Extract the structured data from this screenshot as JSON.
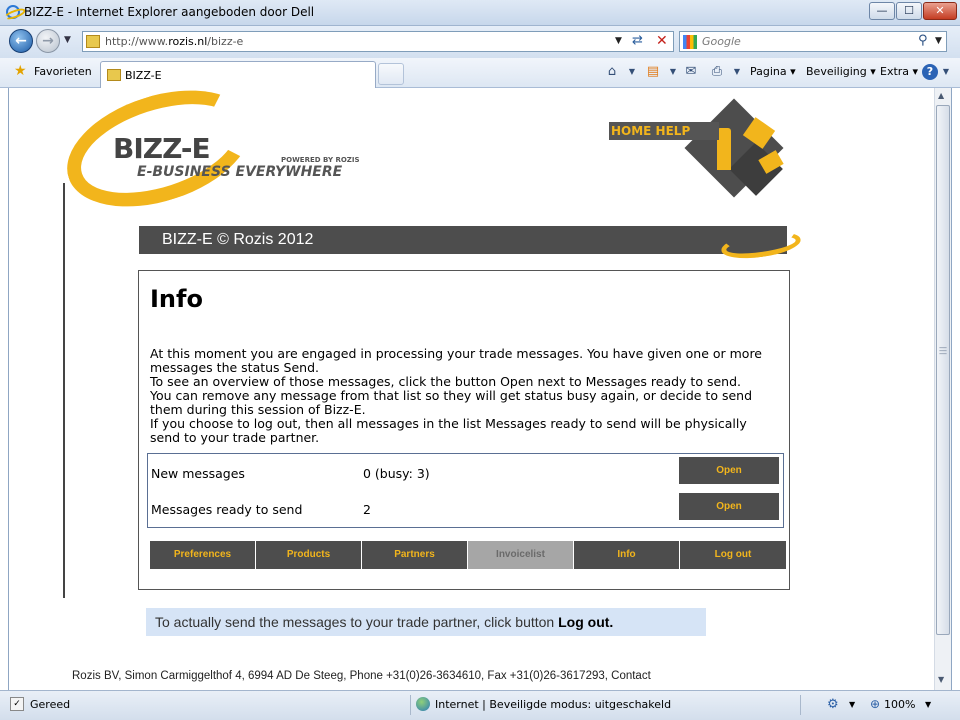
{
  "window": {
    "title": "BIZZ-E - Internet Explorer aangeboden door Dell",
    "minimize": "—",
    "maximize": "☐",
    "close": "✕"
  },
  "address": {
    "url_prefix": "http://www.",
    "url_domain": "rozis.nl",
    "url_path": "/bizz-e",
    "search_placeholder": "Google"
  },
  "favorites": {
    "label": "Favorieten",
    "tab_label": "BIZZ-E"
  },
  "commands": {
    "page": "Pagina",
    "security": "Beveiliging",
    "extra": "Extra"
  },
  "page": {
    "logo_name": "BIZZ-E",
    "logo_tagline": "E-BUSINESS EVERYWHERE",
    "logo_powered": "POWERED BY ROZIS",
    "home_help": "HOME HELP",
    "banner": "BIZZ-E © Rozis 2012",
    "info_title": "Info",
    "info_lines": [
      "At this moment you are engaged in processing your trade messages. You have given one or more",
      "messages the status Send.",
      "To see an overview of those messages, click the button Open next to Messages ready to send.",
      "You can remove any message from that list so they will get status busy again, or decide to send",
      "them during this session of Bizz-E.",
      "If you choose to log out, then all messages in the list Messages ready to send will be physically",
      "send to your trade partner."
    ],
    "messages": [
      {
        "label": "New messages",
        "value": "0 (busy: 3)",
        "button": "Open"
      },
      {
        "label": "Messages ready to send",
        "value": "2",
        "button": "Open"
      }
    ],
    "nav": [
      {
        "label": "Preferences",
        "active": false
      },
      {
        "label": "Products",
        "active": false
      },
      {
        "label": "Partners",
        "active": false
      },
      {
        "label": "Invoicelist",
        "active": true
      },
      {
        "label": "Info",
        "active": false
      },
      {
        "label": "Log out",
        "active": false
      }
    ],
    "hint_text": "To actually send the messages to your trade partner, click button ",
    "hint_bold": "Log out.",
    "footer": "Rozis BV, Simon Carmiggelthof 4, 6994 AD De Steeg, Phone +31(0)26-3634610, Fax +31(0)26-3617293, Contact"
  },
  "status": {
    "ready": "Gereed",
    "zone": "Internet | Beveiligde modus: uitgeschakeld",
    "zoom": "100%"
  },
  "colors": {
    "accent_yellow": "#f2b51c",
    "dark_gray": "#4d4d4d",
    "hint_bg": "#d6e4f6"
  }
}
